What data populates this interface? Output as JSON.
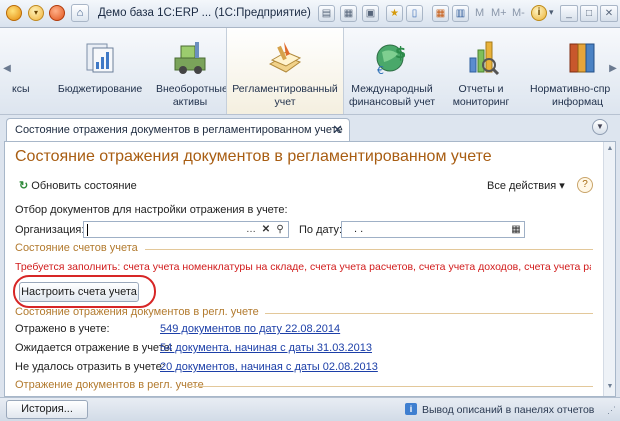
{
  "window": {
    "title": "Демо база 1С:ERP ...  (1С:Предприятие)"
  },
  "titlebar": {
    "m": "M",
    "m_plus": "M+",
    "m_minus": "M-"
  },
  "sections": [
    {
      "label": "ксы",
      "icon": "cutoff-icon"
    },
    {
      "label": "Бюджетирование",
      "icon": "budget-icon"
    },
    {
      "label_l1": "Внеоборотные",
      "label_l2": "активы",
      "icon": "assets-icon"
    },
    {
      "label_l1": "Регламентированный",
      "label_l2": "учет",
      "icon": "regulated-accounting-icon"
    },
    {
      "label_l1": "Международный",
      "label_l2": "финансовый учет",
      "icon": "international-finance-icon"
    },
    {
      "label_l1": "Отчеты и",
      "label_l2": "мониторинг",
      "icon": "reports-icon"
    },
    {
      "label_l1": "Нормативно-спр",
      "label_l2": "информац",
      "icon": "reference-icon"
    }
  ],
  "tab": {
    "label": "Состояние отражения документов в регламентированном учете",
    "close": "✕"
  },
  "page": {
    "title": "Состояние отражения документов в регламентированном учете",
    "refresh_label": "Обновить состояние",
    "all_actions": "Все действия ▾",
    "help": "?",
    "filter_caption": "Отбор документов для настройки отражения в учете:",
    "org_label": "Организация:",
    "org_value": "",
    "date_label": "По дату:",
    "date_value": ". .",
    "accounts_group": "Состояние счетов учета",
    "warning": "Требуется заполнить: счета учета номенклатуры на складе, счета учета расчетов, счета учета доходов, счета учета расхо...",
    "setup_button": "Настроить счета учета",
    "reflection_group": "Состояние отражения документов в регл. учете",
    "rows": [
      {
        "label": "Отражено в учете:",
        "value": "549 документов по дату 22.08.2014"
      },
      {
        "label": "Ожидается отражение в учете:",
        "value": "54 документа, начиная с даты 31.03.2013"
      },
      {
        "label": "Не удалось отразить в учете:",
        "value": "20 документов, начиная с даты 02.08.2013"
      }
    ],
    "reflection_group2": "Отражение документов в регл. учете"
  },
  "status": {
    "history_button": "История...",
    "text": "Вывод описаний в панелях отчетов"
  },
  "colors": {
    "title": "#a85d12",
    "warning": "#d11b1b",
    "link": "#1c3fa8",
    "highlight": "#d72626"
  }
}
